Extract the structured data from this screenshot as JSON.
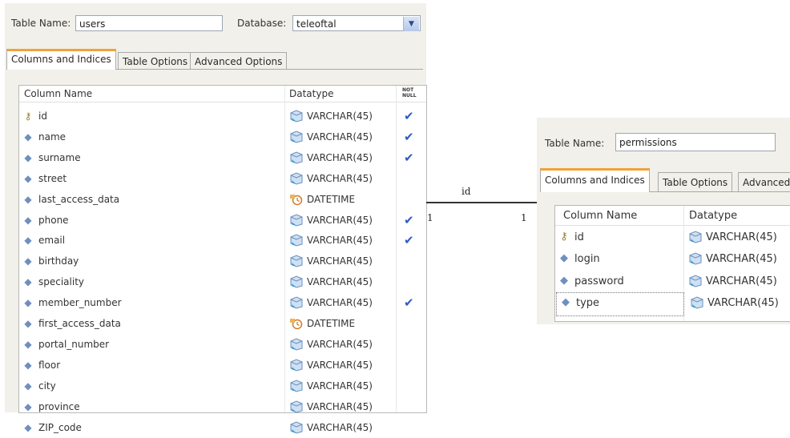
{
  "users_editor": {
    "table_name_label": "Table Name:",
    "table_name_value": "users",
    "database_label": "Database:",
    "database_value": "teleoftal",
    "tabs": [
      {
        "label": "Columns and Indices",
        "active": true
      },
      {
        "label": "Table Options",
        "active": false
      },
      {
        "label": "Advanced Options",
        "active": false
      }
    ],
    "headers": {
      "column_name": "Column Name",
      "datatype": "Datatype",
      "not_null": "NOT NULL"
    },
    "rows": [
      {
        "name": "id",
        "key": true,
        "type": "VARCHAR(45)",
        "dtype_icon": "varchar",
        "not_null": "✔"
      },
      {
        "name": "name",
        "key": false,
        "type": "VARCHAR(45)",
        "dtype_icon": "varchar",
        "not_null": "✔"
      },
      {
        "name": "surname",
        "key": false,
        "type": "VARCHAR(45)",
        "dtype_icon": "varchar",
        "not_null": "✔"
      },
      {
        "name": "street",
        "key": false,
        "type": "VARCHAR(45)",
        "dtype_icon": "varchar",
        "not_null": ""
      },
      {
        "name": "last_access_data",
        "key": false,
        "type": "DATETIME",
        "dtype_icon": "datetime",
        "not_null": ""
      },
      {
        "name": "phone",
        "key": false,
        "type": "VARCHAR(45)",
        "dtype_icon": "varchar",
        "not_null": "✔"
      },
      {
        "name": "email",
        "key": false,
        "type": "VARCHAR(45)",
        "dtype_icon": "varchar",
        "not_null": "✔"
      },
      {
        "name": "birthday",
        "key": false,
        "type": "VARCHAR(45)",
        "dtype_icon": "varchar",
        "not_null": ""
      },
      {
        "name": "speciality",
        "key": false,
        "type": "VARCHAR(45)",
        "dtype_icon": "varchar",
        "not_null": ""
      },
      {
        "name": "member_number",
        "key": false,
        "type": "VARCHAR(45)",
        "dtype_icon": "varchar",
        "not_null": "✔"
      },
      {
        "name": "first_access_data",
        "key": false,
        "type": "DATETIME",
        "dtype_icon": "datetime",
        "not_null": ""
      },
      {
        "name": "portal_number",
        "key": false,
        "type": "VARCHAR(45)",
        "dtype_icon": "varchar",
        "not_null": ""
      },
      {
        "name": "floor",
        "key": false,
        "type": "VARCHAR(45)",
        "dtype_icon": "varchar",
        "not_null": ""
      },
      {
        "name": "city",
        "key": false,
        "type": "VARCHAR(45)",
        "dtype_icon": "varchar",
        "not_null": ""
      },
      {
        "name": "province",
        "key": false,
        "type": "VARCHAR(45)",
        "dtype_icon": "varchar",
        "not_null": ""
      },
      {
        "name": "ZIP_code",
        "key": false,
        "type": "VARCHAR(45)",
        "dtype_icon": "varchar",
        "not_null": ""
      }
    ]
  },
  "relationship": {
    "label": "id",
    "left_cardinality": "1",
    "right_cardinality": "1"
  },
  "permissions_editor": {
    "table_name_label": "Table Name:",
    "table_name_value": "permissions",
    "tabs": [
      {
        "label": "Columns and Indices",
        "active": true
      },
      {
        "label": "Table Options",
        "active": false
      },
      {
        "label": "Advanced",
        "active": false
      }
    ],
    "headers": {
      "column_name": "Column Name",
      "datatype": "Datatype"
    },
    "rows": [
      {
        "name": "id",
        "key": true,
        "type": "VARCHAR(45)",
        "dtype_icon": "varchar"
      },
      {
        "name": "login",
        "key": false,
        "type": "VARCHAR(45)",
        "dtype_icon": "varchar"
      },
      {
        "name": "password",
        "key": false,
        "type": "VARCHAR(45)",
        "dtype_icon": "varchar"
      },
      {
        "name": "type",
        "key": false,
        "type": "VARCHAR(45)",
        "dtype_icon": "varchar"
      }
    ]
  },
  "colors": {
    "active_tab_accent": "#f0a23a",
    "check": "#2f5bc7",
    "panel_bg": "#f1f0ea"
  }
}
